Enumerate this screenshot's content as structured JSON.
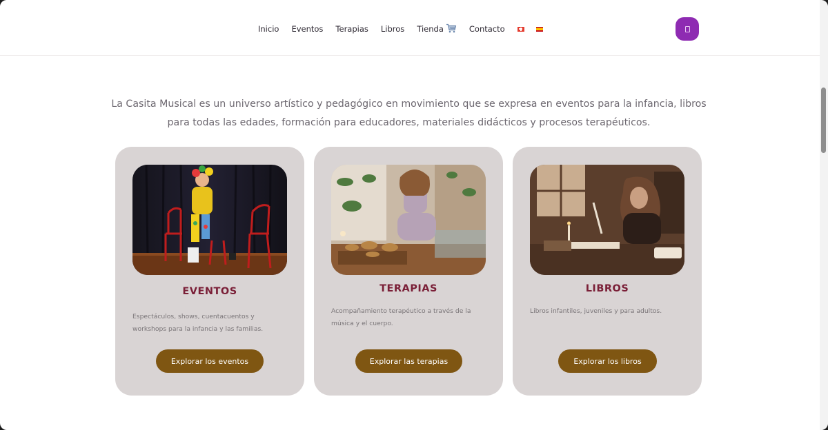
{
  "nav": {
    "items": [
      {
        "id": "inicio",
        "label": "Inicio"
      },
      {
        "id": "eventos",
        "label": "Eventos"
      },
      {
        "id": "terapias",
        "label": "Terapias"
      },
      {
        "id": "libros",
        "label": "Libros"
      },
      {
        "id": "tienda",
        "label": "Tienda"
      },
      {
        "id": "contacto",
        "label": "Contacto"
      }
    ],
    "cart_icon": "shopping-cart-icon",
    "flags": [
      "swiss-flag-icon",
      "spain-flag-icon"
    ],
    "menu_button_color": "#8e2bb2"
  },
  "intro": {
    "text": "La Casita Musical es un universo artístico y pedagógico en movimiento que se expresa en eventos para la infancia, libros para todas las edades, formación para educadores, materiales didácticos y procesos terapéuticos."
  },
  "cards": [
    {
      "title": "EVENTOS",
      "description": "Espectáculos, shows, cuentacuentos y workshops para la infancia y las familias.",
      "button": "Explorar los eventos"
    },
    {
      "title": "TERAPIAS",
      "description": "Acompañamiento terapéutico a través de la música y el cuerpo.",
      "button": "Explorar las terapias"
    },
    {
      "title": "LIBROS",
      "description": "Libros infantiles, juveniles y para adultos.",
      "button": "Explorar los libros"
    }
  ],
  "colors": {
    "card_bg": "#d9d4d4",
    "title": "#7a1f37",
    "button": "#7f5612",
    "accent": "#8e2bb2"
  }
}
